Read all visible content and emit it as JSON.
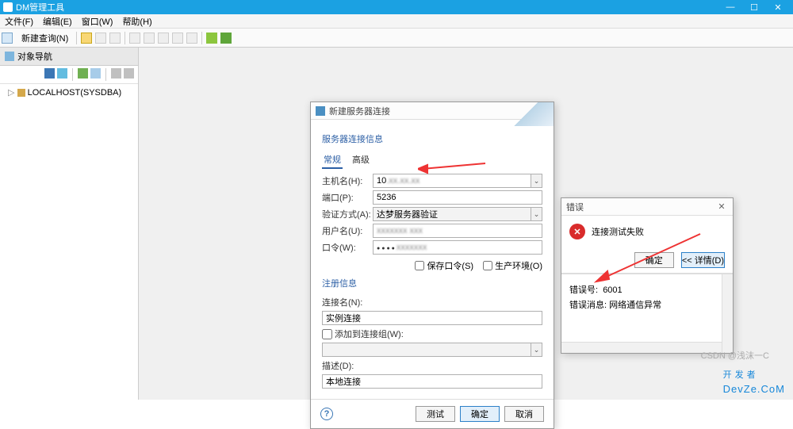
{
  "app": {
    "title": "DM管理工具"
  },
  "menu": {
    "file": "文件(F)",
    "edit": "编辑(E)",
    "window": "窗口(W)",
    "help": "帮助(H)"
  },
  "toolbar": {
    "new_query": "新建查询(N)"
  },
  "sidebar": {
    "title": "对象导航",
    "tree": {
      "root": "LOCALHOST(SYSDBA)"
    }
  },
  "conn_dialog": {
    "title": "新建服务器连接",
    "section_info": "服务器连接信息",
    "tabs": {
      "general": "常规",
      "advanced": "高级"
    },
    "labels": {
      "host": "主机名(H):",
      "port": "端口(P):",
      "auth": "验证方式(A):",
      "user": "用户名(U):",
      "pwd": "口令(W):"
    },
    "values": {
      "host": "10",
      "port": "5236",
      "auth": "达梦服务器验证",
      "user": ""
    },
    "chk": {
      "save_pwd": "保存口令(S)",
      "prod_env": "生产环境(O)"
    },
    "reg_section": "注册信息",
    "reg_labels": {
      "conn_name": "连接名(N):",
      "add_group": "添加到连接组(W):",
      "desc": "描述(D):"
    },
    "reg_values": {
      "conn_name": "实例连接",
      "desc": "本地连接"
    },
    "buttons": {
      "test": "测试",
      "ok": "确定",
      "cancel": "取消"
    }
  },
  "err_dialog": {
    "title": "错误",
    "message": "连接测试失败",
    "buttons": {
      "ok": "确定",
      "details": "<< 详情(D)"
    },
    "err_no_label": "错误号:",
    "err_no": "6001",
    "err_msg_label": "错误消息:",
    "err_msg": "网络通信异常"
  },
  "watermark": {
    "small": "CSDN @浅沫一C",
    "big": "开发者",
    "domain": "DevZe.CoM"
  }
}
